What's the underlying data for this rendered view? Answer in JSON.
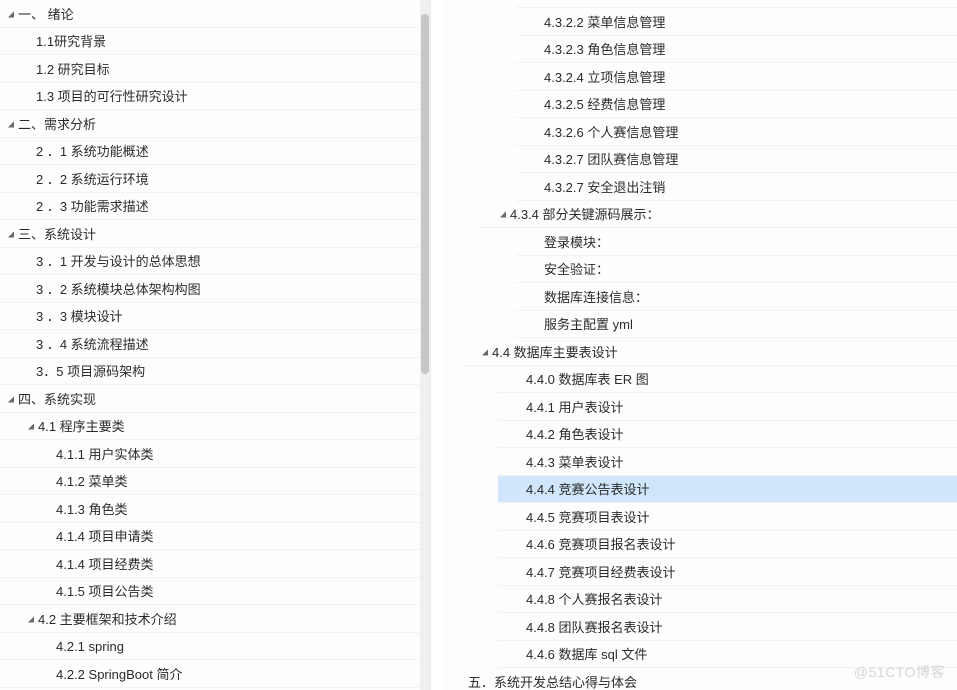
{
  "watermark": "@51CTO博客",
  "left_tree": [
    {
      "indent": 0,
      "arrow": true,
      "label": "一、 绪论"
    },
    {
      "indent": 1,
      "arrow": false,
      "label": "1.1研究背景"
    },
    {
      "indent": 1,
      "arrow": false,
      "label": "1.2 研究目标"
    },
    {
      "indent": 1,
      "arrow": false,
      "label": "1.3 项目的可行性研究设计"
    },
    {
      "indent": 0,
      "arrow": true,
      "label": "二、需求分析"
    },
    {
      "indent": 1,
      "arrow": false,
      "label": "2 ．1 系统功能概述"
    },
    {
      "indent": 1,
      "arrow": false,
      "label": "2 ．2 系统运行环境"
    },
    {
      "indent": 1,
      "arrow": false,
      "label": "2 ．3 功能需求描述"
    },
    {
      "indent": 0,
      "arrow": true,
      "label": "三、系统设计"
    },
    {
      "indent": 1,
      "arrow": false,
      "label": "3 ．1 开发与设计的总体思想"
    },
    {
      "indent": 1,
      "arrow": false,
      "label": "3 ．2 系统模块总体架构构图"
    },
    {
      "indent": 1,
      "arrow": false,
      "label": "3 ．3 模块设计"
    },
    {
      "indent": 1,
      "arrow": false,
      "label": "3 ．4 系统流程描述"
    },
    {
      "indent": 1,
      "arrow": false,
      "label": "3．5 项目源码架构"
    },
    {
      "indent": 0,
      "arrow": true,
      "label": "四、系统实现"
    },
    {
      "indent": 1,
      "arrow": true,
      "label": "4.1  程序主要类"
    },
    {
      "indent": 2,
      "arrow": false,
      "label": "4.1.1 用户实体类"
    },
    {
      "indent": 2,
      "arrow": false,
      "label": "4.1.2 菜单类"
    },
    {
      "indent": 2,
      "arrow": false,
      "label": "4.1.3 角色类"
    },
    {
      "indent": 2,
      "arrow": false,
      "label": "4.1.4 项目申请类"
    },
    {
      "indent": 2,
      "arrow": false,
      "label": "4.1.4 项目经费类"
    },
    {
      "indent": 2,
      "arrow": false,
      "label": "4.1.5 项目公告类"
    },
    {
      "indent": 1,
      "arrow": true,
      "label": "4.2  主要框架和技术介绍"
    },
    {
      "indent": 2,
      "arrow": false,
      "label": "4.2.1 spring"
    },
    {
      "indent": 2,
      "arrow": false,
      "label": "4.2.2 SpringBoot 简介"
    }
  ],
  "right_tree": [
    {
      "indent": 4,
      "arrow": false,
      "label": "",
      "cut": true
    },
    {
      "indent": 4,
      "arrow": false,
      "label": "4.3.2.2  菜单信息管理"
    },
    {
      "indent": 4,
      "arrow": false,
      "label": "4.3.2.3  角色信息管理"
    },
    {
      "indent": 4,
      "arrow": false,
      "label": "4.3.2.4  立项信息管理"
    },
    {
      "indent": 4,
      "arrow": false,
      "label": "4.3.2.5  经费信息管理"
    },
    {
      "indent": 4,
      "arrow": false,
      "label": "4.3.2.6  个人赛信息管理"
    },
    {
      "indent": 4,
      "arrow": false,
      "label": "4.3.2.7  团队赛信息管理"
    },
    {
      "indent": 4,
      "arrow": false,
      "label": "4.3.2.7  安全退出注销"
    },
    {
      "indent": 2,
      "arrow": true,
      "label": "4.3.4 部分关键源码展示："
    },
    {
      "indent": 4,
      "arrow": false,
      "label": "登录模块："
    },
    {
      "indent": 4,
      "arrow": false,
      "label": "安全验证："
    },
    {
      "indent": 4,
      "arrow": false,
      "label": "数据库连接信息："
    },
    {
      "indent": 4,
      "arrow": false,
      "label": "服务主配置 yml"
    },
    {
      "indent": 1,
      "arrow": true,
      "label": "4.4 数据库主要表设计"
    },
    {
      "indent": 3,
      "arrow": false,
      "label": "4.4.0 数据库表 ER 图"
    },
    {
      "indent": 3,
      "arrow": false,
      "label": "4.4.1 用户表设计"
    },
    {
      "indent": 3,
      "arrow": false,
      "label": "4.4.2 角色表设计"
    },
    {
      "indent": 3,
      "arrow": false,
      "label": "4.4.3 菜单表设计"
    },
    {
      "indent": 3,
      "arrow": false,
      "label": "4.4.4 竞赛公告表设计",
      "selected": true
    },
    {
      "indent": 3,
      "arrow": false,
      "label": "4.4.5 竞赛项目表设计"
    },
    {
      "indent": 3,
      "arrow": false,
      "label": "4.4.6 竞赛项目报名表设计"
    },
    {
      "indent": 3,
      "arrow": false,
      "label": "4.4.7 竞赛项目经费表设计"
    },
    {
      "indent": 3,
      "arrow": false,
      "label": "4.4.8 个人赛报名表设计"
    },
    {
      "indent": 3,
      "arrow": false,
      "label": "4.4.8 团队赛报名表设计"
    },
    {
      "indent": 3,
      "arrow": false,
      "label": "4.4.6 数据库 sql 文件"
    },
    {
      "indent": 0,
      "arrow": false,
      "label": "五．系统开发总结心得与体会"
    }
  ]
}
